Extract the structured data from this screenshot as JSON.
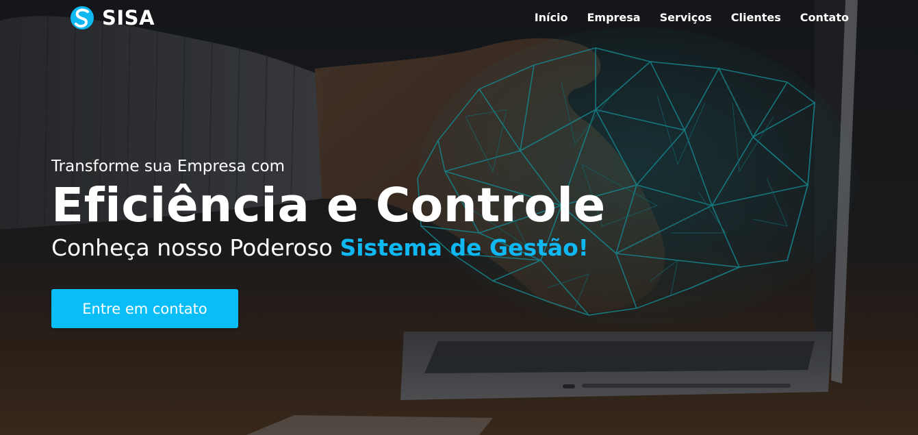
{
  "brand": {
    "name": "SISA"
  },
  "nav": {
    "items": [
      "Início",
      "Empresa",
      "Serviços",
      "Clientes",
      "Contato"
    ]
  },
  "hero": {
    "kicker": "Transforme sua Empresa com",
    "title": "Eficiência e Controle",
    "subtitle_prefix": "Conheça nosso Poderoso ",
    "subtitle_highlight": "Sistema de Gestão!",
    "cta_label": "Entre em contato"
  },
  "colors": {
    "accent": "#10b8f2",
    "button": "#09bdf7",
    "background": "#1f2022"
  },
  "icons": {
    "logo": "sisa-logo-icon"
  }
}
